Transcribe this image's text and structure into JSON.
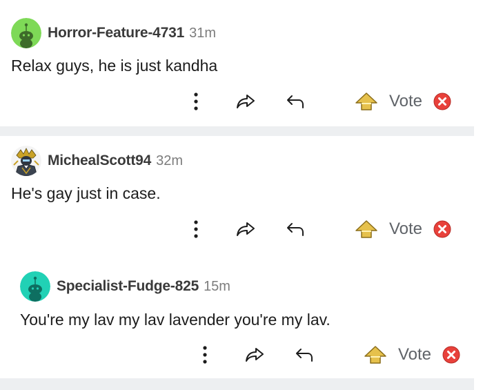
{
  "comments": [
    {
      "username": "Horror-Feature-4731",
      "time": "31m",
      "text": "Relax guys, he is just kandha",
      "vote_label": "Vote",
      "avatar": "snoo-green-icon"
    },
    {
      "username": "MichealScott94",
      "time": "32m",
      "text": "He's gay just in case.",
      "vote_label": "Vote",
      "avatar": "armored-knight-icon"
    },
    {
      "username": "Specialist-Fudge-825",
      "time": "15m",
      "text": "You're my lav my lav lavender you're my lav.",
      "vote_label": "Vote",
      "avatar": "snoo-teal-icon"
    }
  ],
  "colors": {
    "avatar_green": "#7ed957",
    "avatar_teal": "#21d1b5",
    "divider": "#edeff1",
    "downvote_red": "#e8413b",
    "upvote_gold": "#d9b13b"
  }
}
